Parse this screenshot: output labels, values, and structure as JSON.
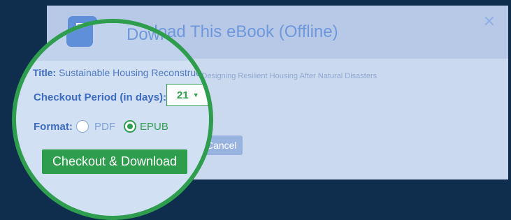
{
  "modal": {
    "title": "Download This eBook (Offline)",
    "close_icon": "close-icon",
    "book_title_label": "Title:",
    "book_title_value": "Sustainable Housing Reconstruction: Designing Resilient Housing After Natural Disasters",
    "checkout_period_label": "Checkout Period (in days):",
    "checkout_period_value": "21",
    "format_label": "Format:",
    "format_options": [
      "PDF",
      "EPUB"
    ],
    "format_selected": "EPUB",
    "checkout_button": "Checkout & Download",
    "cancel_button": "Cancel"
  },
  "colors": {
    "background": "#0f2d4d",
    "accent_green": "#2e9e4e",
    "accent_blue": "#3c6bc2"
  }
}
